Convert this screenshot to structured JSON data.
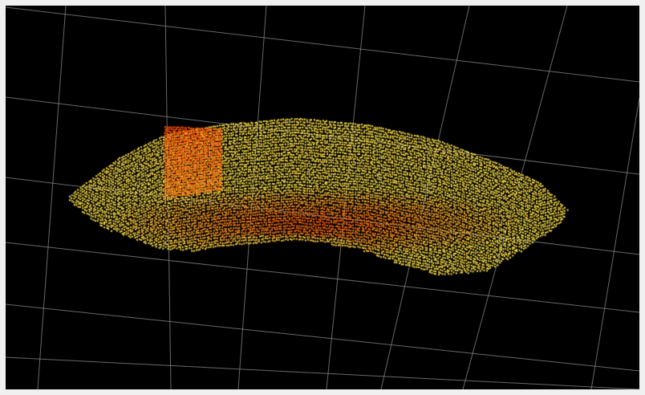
{
  "viewer": {
    "background_color": "#000000",
    "frame_color": "#f0f0f0",
    "grid_color": "#8a8a8a",
    "point_colors": {
      "core": "#ff4a00",
      "mid": "#ff8a1a",
      "edge": "#ffe24a"
    }
  }
}
